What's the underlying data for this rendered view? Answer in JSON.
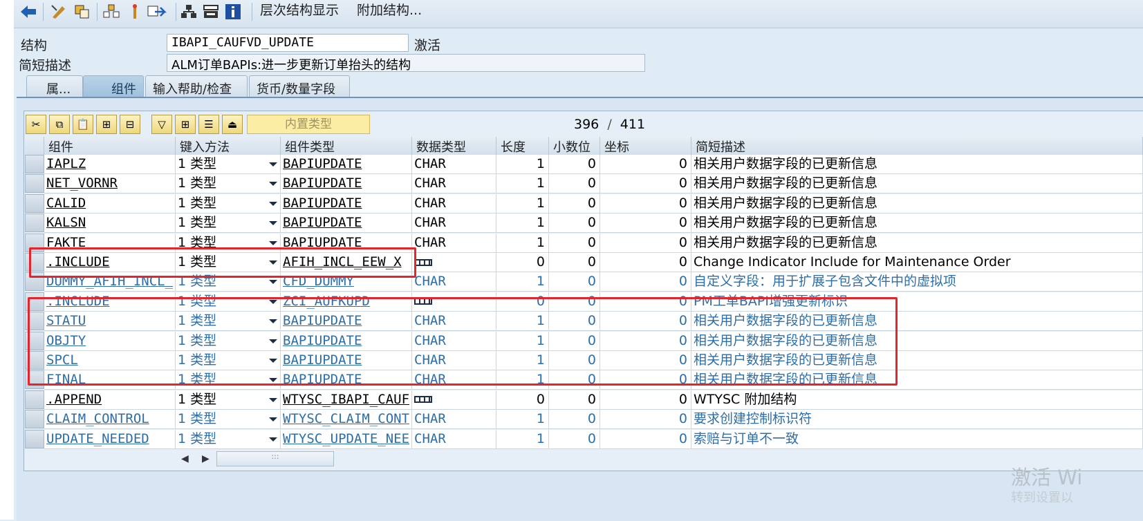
{
  "toolbar": {
    "buttons": [
      "back-arrow-icon",
      "display-change-icon",
      "other-object-icon",
      "where-used-icon",
      "activate-icon",
      "test-icon",
      "hierarchy-icon",
      "print-icon",
      "info-icon"
    ],
    "menu": [
      "层次结构显示",
      "附加结构..."
    ]
  },
  "header": {
    "structure_label": "结构",
    "structure_value": "IBAPI_CAUFVD_UPDATE",
    "status": "激活",
    "desc_label": "简短描述",
    "desc_value": "ALM订单BAPIs:进一步更新订单抬头的结构"
  },
  "tabs": [
    "属...",
    "组件",
    "输入帮助/检查",
    "货币/数量字段"
  ],
  "grid_toolbar": {
    "builtin_type": "内置类型",
    "counter_current": "396",
    "counter_sep": "/",
    "counter_total": "411"
  },
  "columns": [
    "组件",
    "键入方法",
    "组件类型",
    "数据类型",
    "长度",
    "小数位",
    "坐标",
    "简短描述"
  ],
  "rows": [
    {
      "component": "IAPLZ",
      "method": "1 类型",
      "type": "BAPIUPDATE",
      "dtype": "CHAR",
      "len": "1",
      "dec": "0",
      "coord": "0",
      "desc": "相关用户数据字段的已更新信息"
    },
    {
      "component": "NET_VORNR",
      "method": "1 类型",
      "type": "BAPIUPDATE",
      "dtype": "CHAR",
      "len": "1",
      "dec": "0",
      "coord": "0",
      "desc": "相关用户数据字段的已更新信息"
    },
    {
      "component": "CALID",
      "method": "1 类型",
      "type": "BAPIUPDATE",
      "dtype": "CHAR",
      "len": "1",
      "dec": "0",
      "coord": "0",
      "desc": "相关用户数据字段的已更新信息"
    },
    {
      "component": "KALSN",
      "method": "1 类型",
      "type": "BAPIUPDATE",
      "dtype": "CHAR",
      "len": "1",
      "dec": "0",
      "coord": "0",
      "desc": "相关用户数据字段的已更新信息"
    },
    {
      "component": "FAKTE",
      "method": "1 类型",
      "type": "BAPIUPDATE",
      "dtype": "CHAR",
      "len": "1",
      "dec": "0",
      "coord": "0",
      "desc": "相关用户数据字段的已更新信息"
    },
    {
      "component": ".INCLUDE",
      "method": "1 类型",
      "type": "AFIH_INCL_EEW_X",
      "dtype": "",
      "len": "0",
      "dec": "0",
      "coord": "0",
      "desc": "Change Indicator Include for Maintenance Order"
    },
    {
      "component": "DUMMY_AFIH_INCL_",
      "method": "1 类型",
      "type": "CFD_DUMMY",
      "dtype": "CHAR",
      "len": "1",
      "dec": "0",
      "coord": "0",
      "desc": "自定义字段：用于扩展子包含文件中的虚拟项"
    },
    {
      "component": ".INCLUDE",
      "method": "1 类型",
      "type": "ZCI_AUFKUPD",
      "dtype": "",
      "len": "0",
      "dec": "0",
      "coord": "0",
      "desc": "PM工单BAPI增强更新标识"
    },
    {
      "component": "STATU",
      "method": "1 类型",
      "type": "BAPIUPDATE",
      "dtype": "CHAR",
      "len": "1",
      "dec": "0",
      "coord": "0",
      "desc": "相关用户数据字段的已更新信息"
    },
    {
      "component": "OBJTY",
      "method": "1 类型",
      "type": "BAPIUPDATE",
      "dtype": "CHAR",
      "len": "1",
      "dec": "0",
      "coord": "0",
      "desc": "相关用户数据字段的已更新信息"
    },
    {
      "component": "SPCL",
      "method": "1 类型",
      "type": "BAPIUPDATE",
      "dtype": "CHAR",
      "len": "1",
      "dec": "0",
      "coord": "0",
      "desc": "相关用户数据字段的已更新信息"
    },
    {
      "component": "FINAL",
      "method": "1 类型",
      "type": "BAPIUPDATE",
      "dtype": "CHAR",
      "len": "1",
      "dec": "0",
      "coord": "0",
      "desc": "相关用户数据字段的已更新信息"
    },
    {
      "component": ".APPEND",
      "method": "1 类型",
      "type": "WTYSC_IBAPI_CAUF",
      "dtype": "",
      "len": "0",
      "dec": "0",
      "coord": "0",
      "desc": "WTYSC 附加结构"
    },
    {
      "component": "CLAIM_CONTROL",
      "method": "1 类型",
      "type": "WTYSC_CLAIM_CONT",
      "dtype": "CHAR",
      "len": "1",
      "dec": "0",
      "coord": "0",
      "desc": "要求创建控制标识符"
    },
    {
      "component": "UPDATE_NEEDED",
      "method": "1 类型",
      "type": "WTYSC_UPDATE_NEE",
      "dtype": "CHAR",
      "len": "1",
      "dec": "0",
      "coord": "0",
      "desc": "索赔与订单不一致"
    }
  ],
  "row_styles": [
    "dark",
    "dark",
    "dark",
    "dark",
    "dark",
    "dark",
    "blue",
    "blue",
    "blue",
    "blue",
    "blue",
    "blue",
    "dark",
    "blue",
    "blue"
  ],
  "watermark": {
    "line1": "激活 Wi",
    "line2": "转到设置以"
  }
}
